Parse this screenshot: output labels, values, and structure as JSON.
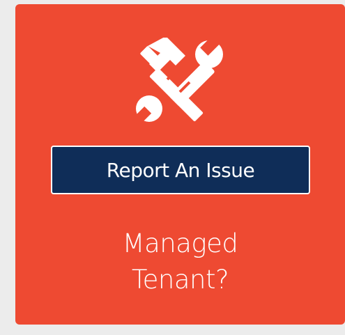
{
  "card": {
    "background_color": "#ee4a32",
    "icon": "hammer-wrench-icon",
    "button_label": "Report An Issue",
    "button_color": "#0f2d58",
    "caption_line1": "Managed",
    "caption_line2": "Tenant?"
  }
}
